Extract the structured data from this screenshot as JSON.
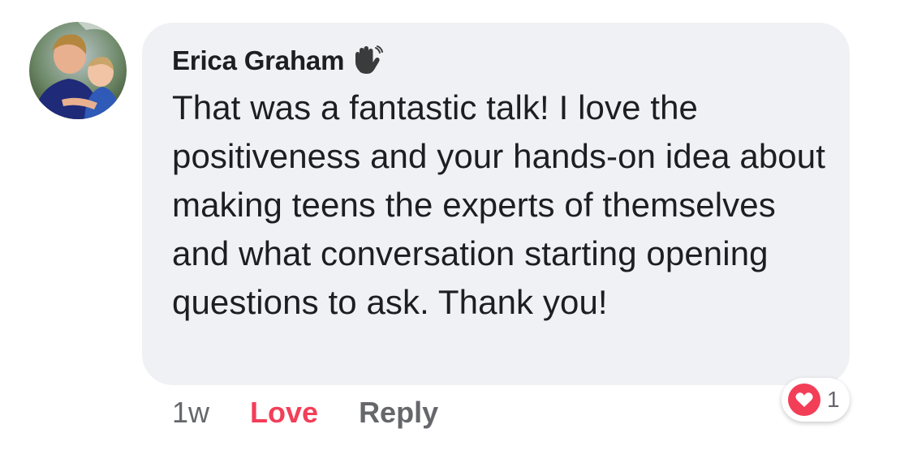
{
  "comment": {
    "author": "Erica Graham",
    "author_badge_icon": "waving-hand-icon",
    "avatar_icon": "profile-photo",
    "body": "That was a fantastic talk! I love the positiveness and your hands-on idea about making teens the experts of themselves and what conversation starting opening questions to ask. Thank you!",
    "bubble_color": "#f0f1f4"
  },
  "actions": {
    "timestamp": "1w",
    "love_label": "Love",
    "love_color": "#f33e58",
    "reply_label": "Reply"
  },
  "reactions": {
    "icon": "heart-icon",
    "color": "#f33e58",
    "count": "1"
  }
}
